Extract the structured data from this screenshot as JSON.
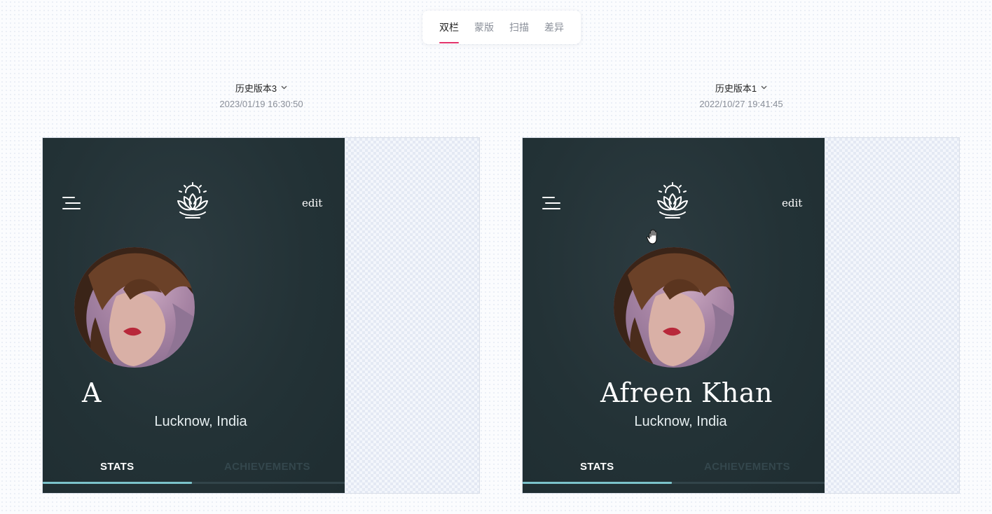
{
  "mode_tabs": [
    "双栏",
    "蒙版",
    "扫描",
    "差异"
  ],
  "left": {
    "version": "历史版本3",
    "timestamp": "2023/01/19 16:30:50",
    "edit_label": "edit",
    "name": "A",
    "location": "Lucknow, India",
    "tab_stats": "STATS",
    "tab_achievements": "ACHIEVEMENTS"
  },
  "right": {
    "version": "历史版本1",
    "timestamp": "2022/10/27 19:41:45",
    "edit_label": "edit",
    "name": "Afreen Khan",
    "location": "Lucknow, India",
    "tab_stats": "STATS",
    "tab_achievements": "ACHIEVEMENTS"
  },
  "colors": {
    "accent_tab": "#e3336b",
    "app_bg": "#233236",
    "progress": "#7bc2ca"
  },
  "stats_progress": 0.5,
  "icons": [
    "chevron-down-icon",
    "menu-icon",
    "lotus-logo-icon",
    "hand-cursor-icon"
  ]
}
